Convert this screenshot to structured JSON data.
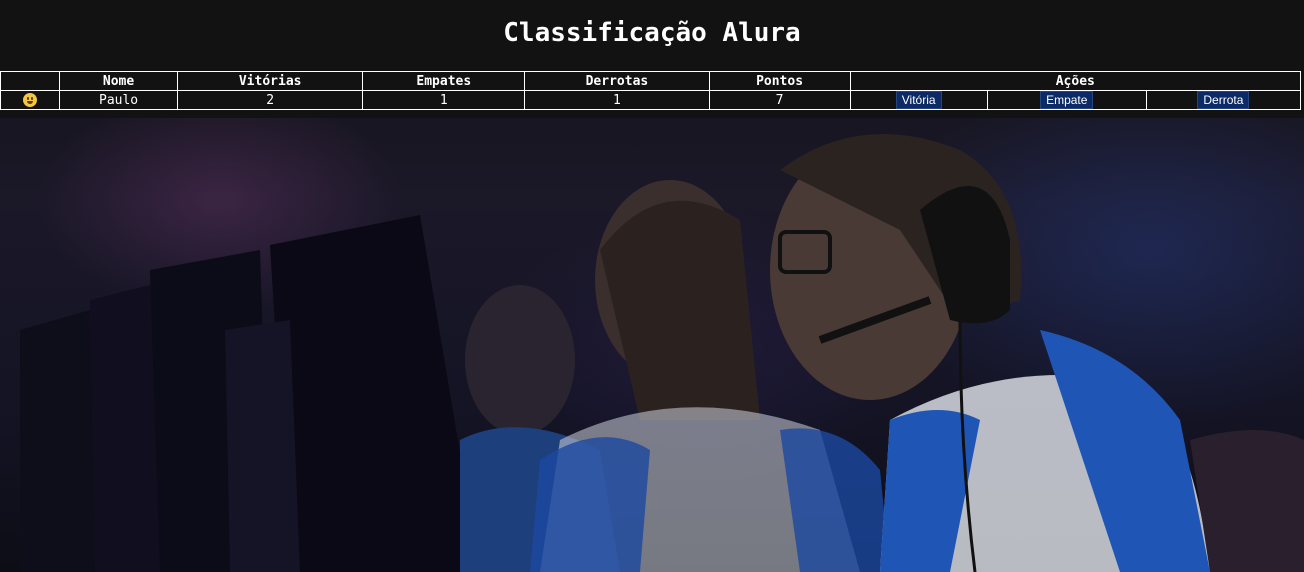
{
  "page": {
    "title": "Classificação Alura"
  },
  "table": {
    "headers": [
      "",
      "Nome",
      "Vitórias",
      "Empates",
      "Derrotas",
      "Pontos",
      "Ações"
    ],
    "rows": [
      {
        "icon": "grinning-face-icon",
        "nome": "Paulo",
        "vitorias": "2",
        "empates": "1",
        "derrotas": "1",
        "pontos": "7",
        "acoes": {
          "vitoria": "Vitória",
          "empate": "Empate",
          "derrota": "Derrota"
        }
      }
    ]
  },
  "colors": {
    "button_bg": "#0c2a66",
    "text": "#ffffff",
    "header_bg": "#121212"
  }
}
